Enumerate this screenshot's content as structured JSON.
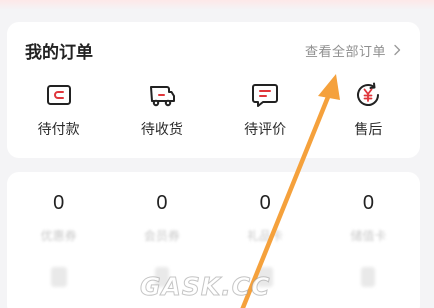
{
  "orders": {
    "title": "我的订单",
    "view_all": "查看全部订单",
    "items": [
      {
        "label": "待付款",
        "icon": "wallet-icon"
      },
      {
        "label": "待收货",
        "icon": "truck-icon"
      },
      {
        "label": "待评价",
        "icon": "comment-icon"
      },
      {
        "label": "售后",
        "icon": "yuan-refund-icon"
      }
    ]
  },
  "assets": {
    "items": [
      {
        "count": "0",
        "label": "优惠券"
      },
      {
        "count": "0",
        "label": "会员券"
      },
      {
        "count": "0",
        "label": "礼品卡"
      },
      {
        "count": "0",
        "label": "储值卡"
      }
    ]
  },
  "watermark": "GASK.CC",
  "colors": {
    "accent": "#e0363b",
    "arrow": "#f5a13c",
    "page_bg": "#f4f4f6"
  }
}
